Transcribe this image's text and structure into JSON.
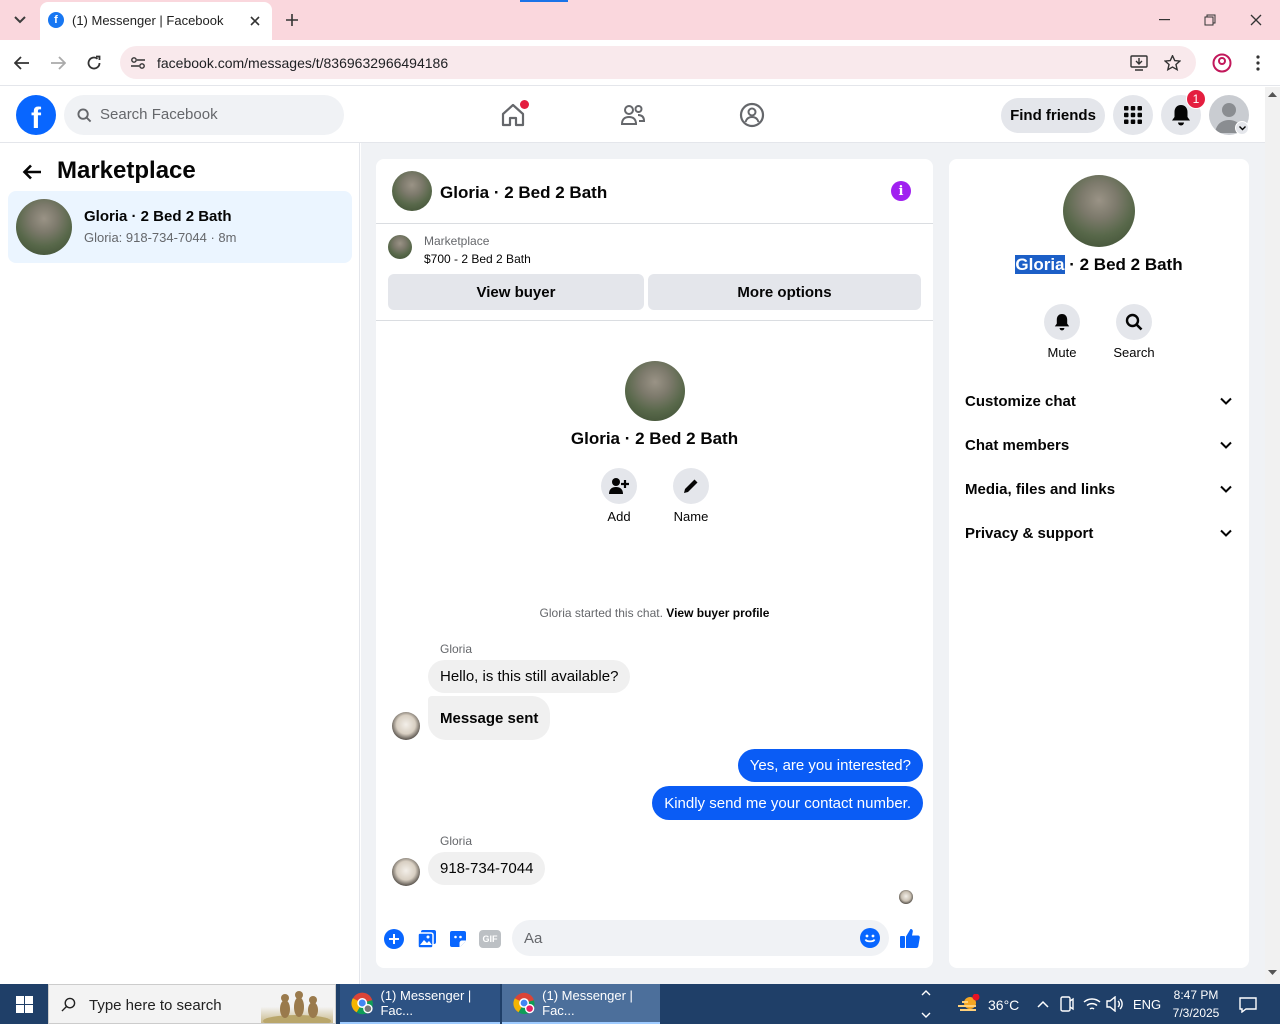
{
  "browser": {
    "tab_title": "(1) Messenger | Facebook",
    "url": "facebook.com/messages/t/8369632966494186"
  },
  "fb_header": {
    "search_placeholder": "Search Facebook",
    "find_friends": "Find friends",
    "notification_count": "1",
    "accent": "#0866ff"
  },
  "sidebar": {
    "title": "Marketplace",
    "conversations": [
      {
        "name": "Gloria · 2 Bed 2 Bath",
        "preview": "Gloria: 918-734-7044 · 8m"
      }
    ]
  },
  "chat": {
    "header_title": "Gloria · 2 Bed 2 Bath",
    "listing_source": "Marketplace",
    "listing_detail": "$700 - 2 Bed 2 Bath",
    "view_buyer": "View buyer",
    "more_options": "More options",
    "profile_name": "Gloria · 2 Bed 2 Bath",
    "add_label": "Add",
    "name_label": "Name",
    "started_text": "Gloria started this chat.",
    "view_buyer_profile": "View buyer profile",
    "messages": [
      {
        "sender": "Gloria",
        "text": "Hello, is this still available?"
      },
      {
        "text": "Message sent"
      },
      {
        "self": true,
        "text": "Yes, are you interested?"
      },
      {
        "self": true,
        "text": "Kindly send me your contact number."
      },
      {
        "sender": "Gloria",
        "text": "918-734-7044"
      }
    ],
    "composer_placeholder": "Aa",
    "gif_label": "GIF"
  },
  "info_panel": {
    "name_highlight": "Gloria",
    "name_rest": " · 2 Bed 2 Bath",
    "mute": "Mute",
    "search": "Search",
    "sections": [
      "Customize chat",
      "Chat members",
      "Media, files and links",
      "Privacy & support"
    ]
  },
  "taskbar": {
    "search_placeholder": "Type here to search",
    "window1": "(1) Messenger | Fac...",
    "window2": "(1) Messenger | Fac...",
    "temperature": "36°C",
    "language": "ENG",
    "time": "8:47 PM",
    "date": "7/3/2025"
  }
}
